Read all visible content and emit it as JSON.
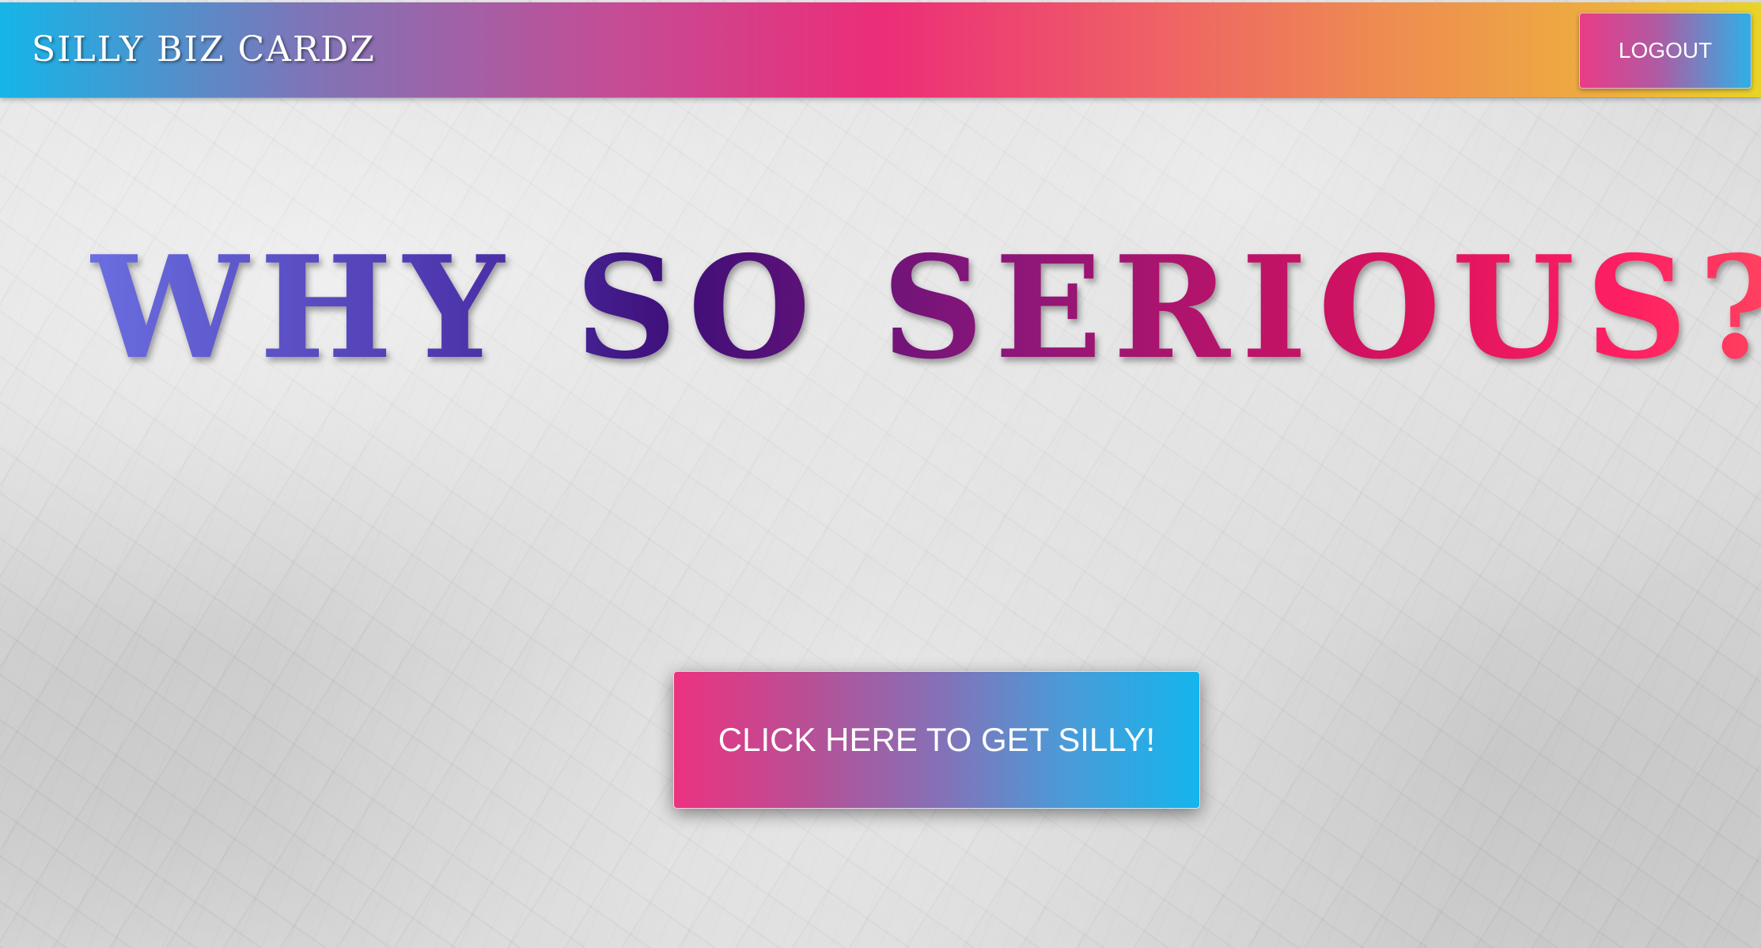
{
  "navbar": {
    "brand": "SILLY BIZ CARDZ",
    "logout_label": "LOGOUT"
  },
  "hero": {
    "headline": "WHY SO SERIOUS?",
    "cta_label": "CLICK HERE TO GET SILLY!"
  }
}
